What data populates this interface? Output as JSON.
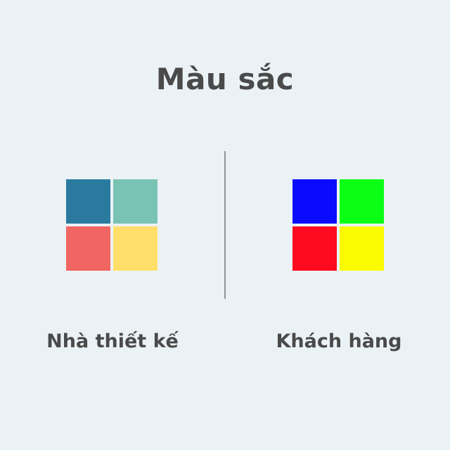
{
  "title": "Màu sắc",
  "panels": [
    {
      "label": "Nhà thiết kế",
      "colors": [
        "#2a7aa0",
        "#7ac3b4",
        "#f16662",
        "#ffdf69"
      ]
    },
    {
      "label": "Khách hàng",
      "colors": [
        "#0a0aff",
        "#0aff14",
        "#ff0a1e",
        "#fafa00"
      ]
    }
  ]
}
